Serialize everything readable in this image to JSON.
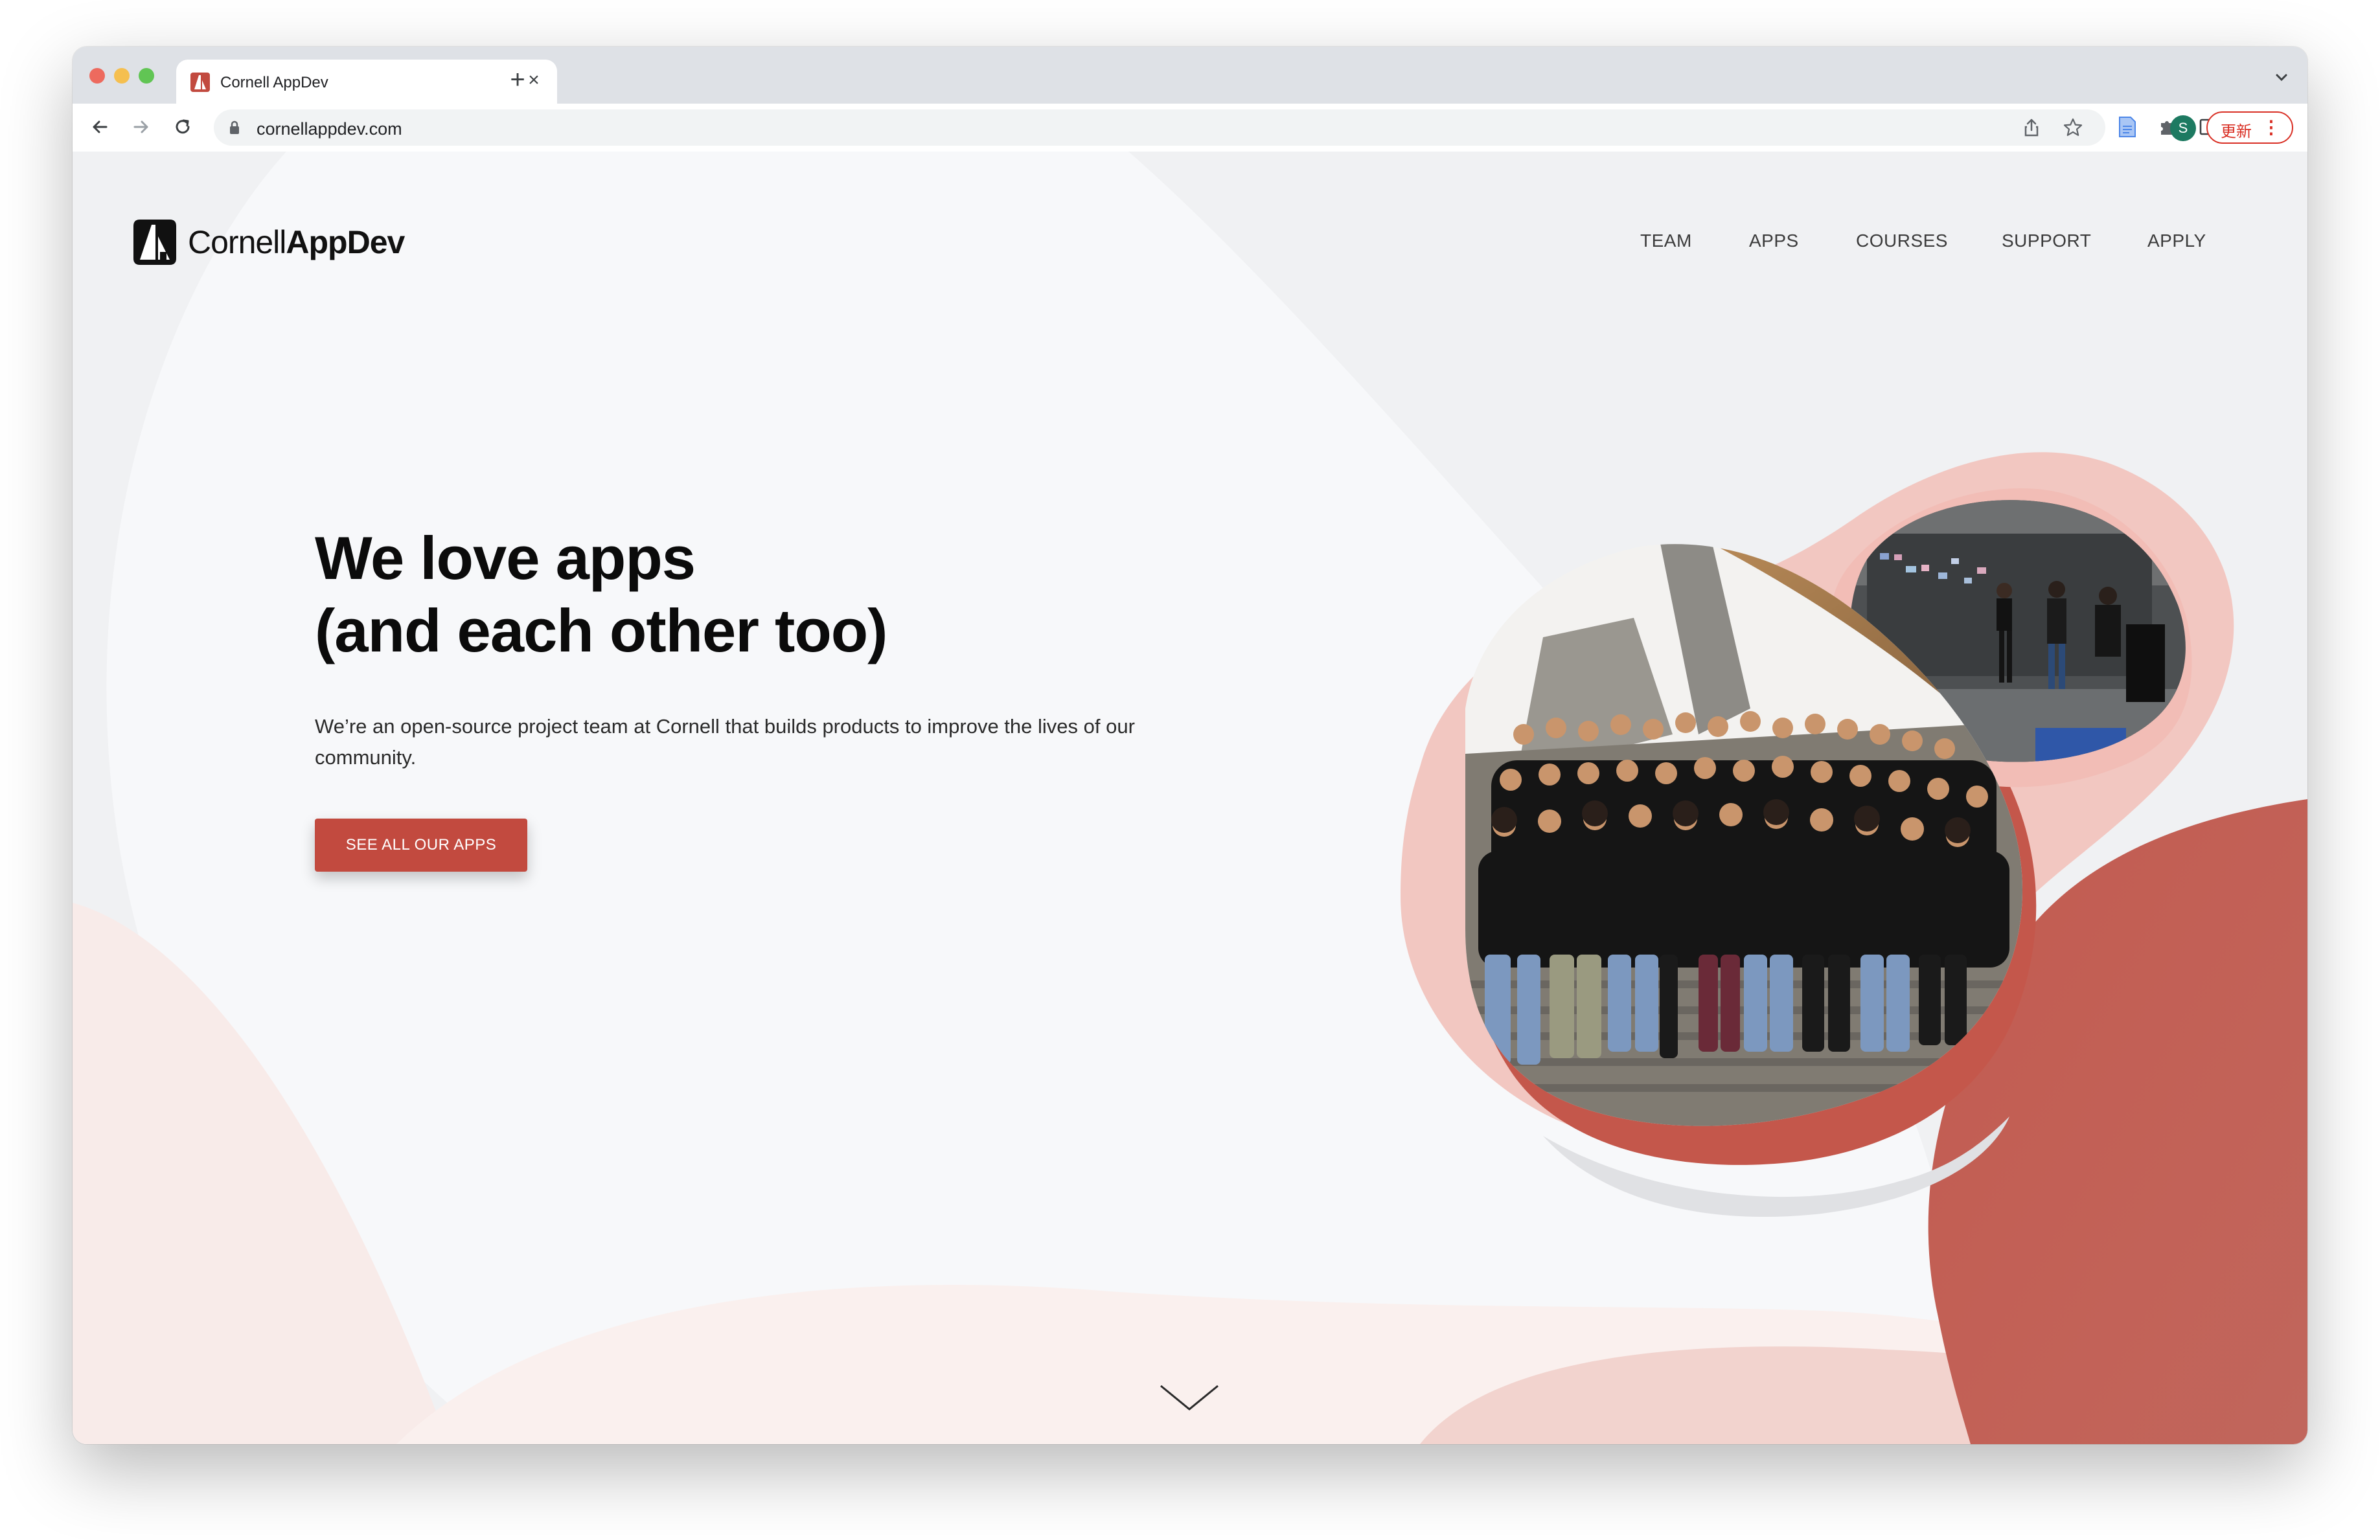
{
  "browser": {
    "tab": {
      "title": "Cornell AppDev"
    },
    "new_tab_symbol": "+",
    "close_symbol": "×",
    "url": "cornellappdev.com",
    "avatar_letter": "S",
    "update_label": "更新",
    "update_menu_symbol": "⋮",
    "icons": [
      "back-arrow-icon",
      "forward-arrow-icon",
      "reload-icon",
      "lock-icon",
      "share-icon",
      "star-icon",
      "extension-icon",
      "side-panel-icon",
      "tab-search-icon"
    ]
  },
  "site": {
    "logo": {
      "prefix": "Cornell",
      "suffix": "AppDev"
    },
    "nav": [
      "TEAM",
      "APPS",
      "COURSES",
      "SUPPORT",
      "APPLY"
    ],
    "hero": {
      "headline_1": "We love apps",
      "headline_2": "(and each other too)",
      "intro": "We’re an open-source project team at Cornell that builds products to improve the lives of our community.",
      "cta": "SEE ALL OUR APPS"
    },
    "images": [
      "team-group-photo",
      "team-whiteboard-photo"
    ],
    "scroll_icon": "chevron-down-icon"
  },
  "colors": {
    "brand_red": "#c24a3f",
    "blob_pink": "#efc2bc",
    "blob_light": "#f6dcd7",
    "page_bg": "#f6f7f9",
    "tab_strip": "#dee1e6"
  }
}
